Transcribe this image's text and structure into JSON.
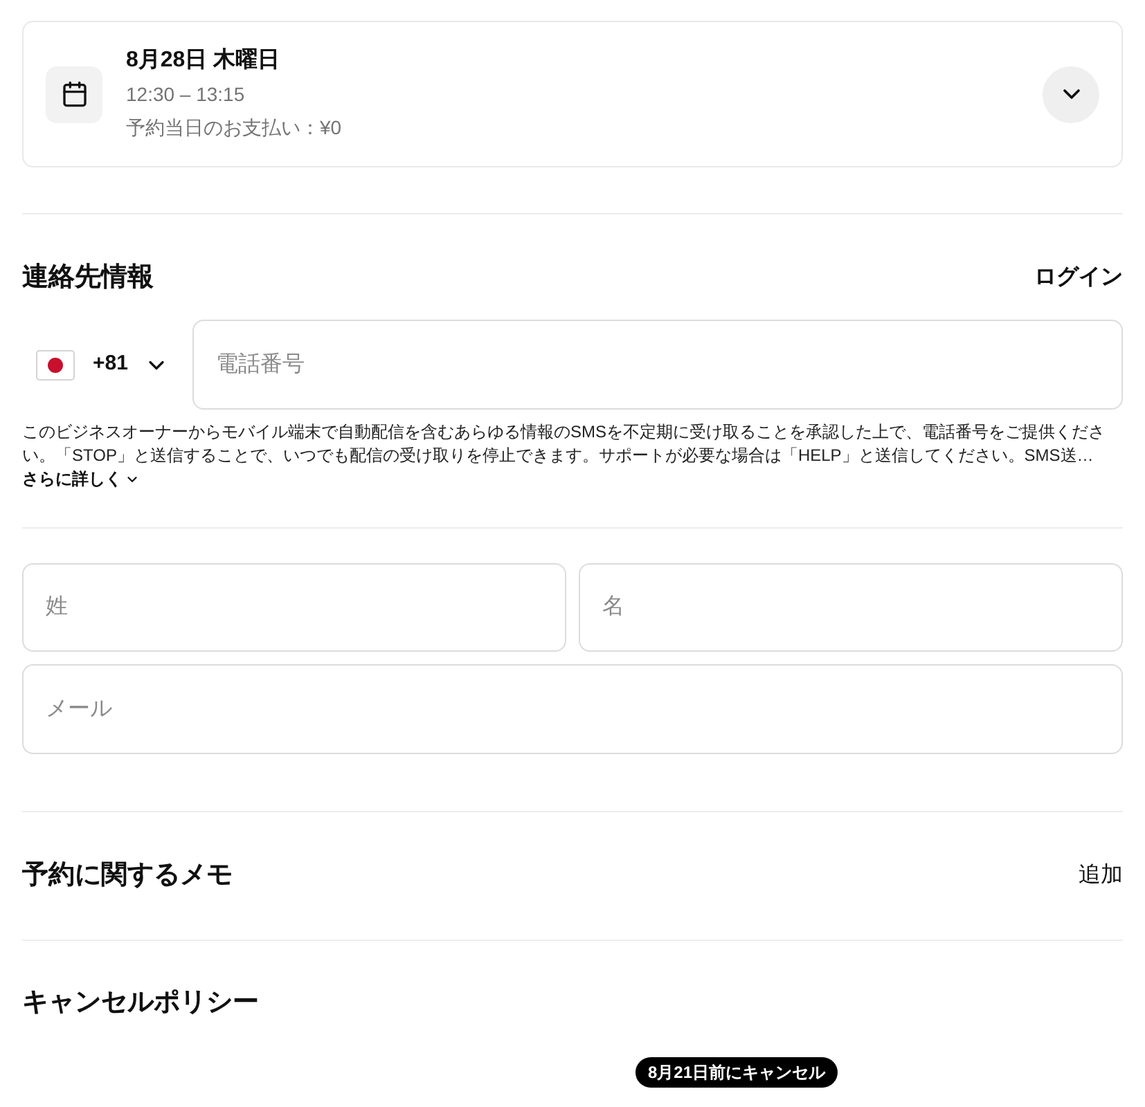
{
  "appointment": {
    "date": "8月28日 木曜日",
    "time": "12:30 – 13:15",
    "payment": "予約当日のお支払い：¥0",
    "expanded": false
  },
  "contact": {
    "title": "連絡先情報",
    "login": "ログイン",
    "phone": {
      "country_code": "+81",
      "placeholder": "電話番号"
    },
    "disclaimer": "このビジネスオーナーからモバイル端末で自動配信を含むあらゆる情報のSMSを不定期に受け取ることを承認した上で、電話番号をご提供ください。「STOP」と送信することで、いつでも配信の受け取りを停止できます。サポートが必要な場合は「HELP」と送信してください。SMS送…",
    "more": "さらに詳しく"
  },
  "name_fields": [
    {
      "placeholder": "姓"
    },
    {
      "placeholder": "名"
    }
  ],
  "email": {
    "placeholder": "メール"
  },
  "memo": {
    "title": "予約に関するメモ",
    "action": "追加"
  },
  "cancel_policy": {
    "title": "キャンセルポリシー",
    "badge": "8月21日前にキャンセル"
  }
}
